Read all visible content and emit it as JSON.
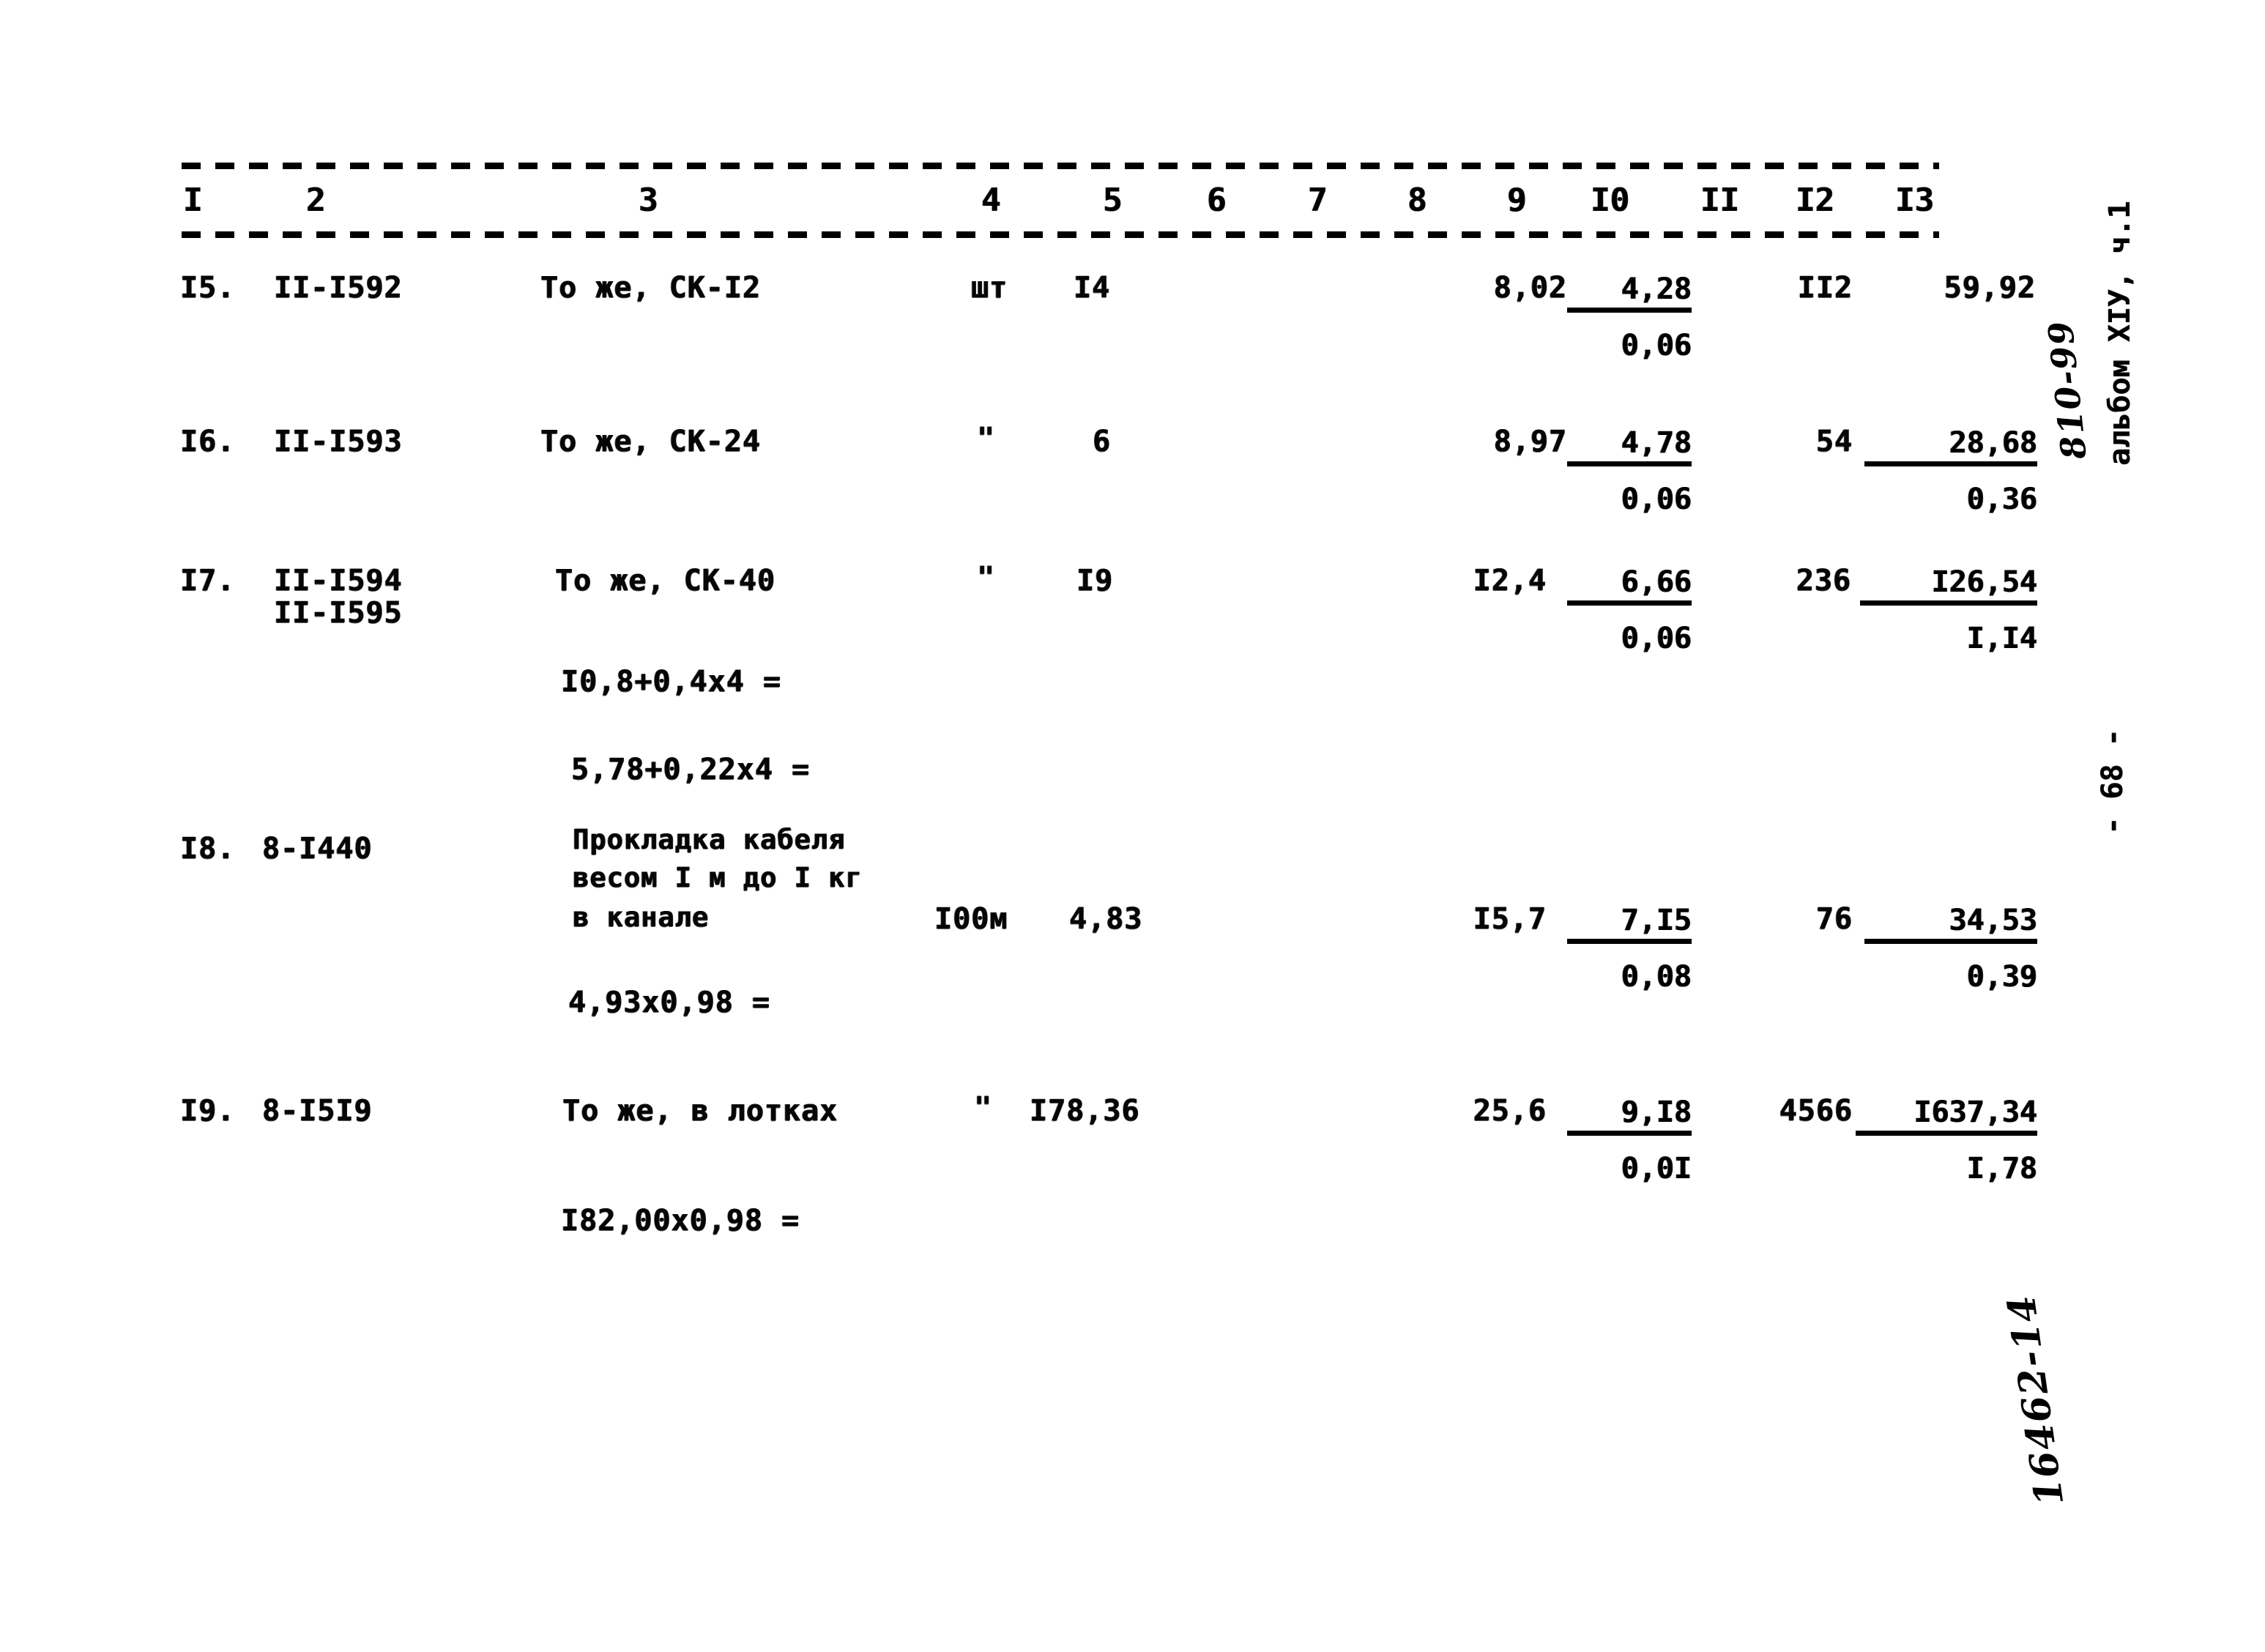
{
  "document": {
    "kind": "scanned-estimate-table",
    "margin_stamp_typed": "альбом XIУ, ч.1",
    "margin_stamp_handwritten": "810-99",
    "page_number": "- 68 -",
    "bottom_handwritten_code": "16462-14"
  },
  "table": {
    "column_numbers": [
      "I",
      "2",
      "3",
      "4",
      "5",
      "6",
      "7",
      "8",
      "9",
      "I0",
      "II",
      "I2",
      "I3"
    ],
    "rows": [
      {
        "num": "I5.",
        "code": "II-I592",
        "code2": "",
        "description": "То же, СК-I2",
        "unit": "шт",
        "quantity": "I4",
        "col8": "8,02",
        "col9_num": "4,28",
        "col9_den": "0,06",
        "col12": "II2",
        "col13_num": "59,92",
        "col13_den": ""
      },
      {
        "num": "I6.",
        "code": "II-I593",
        "code2": "",
        "description": "То же, СК-24",
        "unit": "\"",
        "quantity": "6",
        "col8": "8,97",
        "col9_num": "4,78",
        "col9_den": "0,06",
        "col12": "54",
        "col13_num": "28,68",
        "col13_den": "0,36"
      },
      {
        "num": "I7.",
        "code": "II-I594",
        "code2": "II-I595",
        "description": "То же, СК-40",
        "unit": "\"",
        "quantity": "I9",
        "col8": "I2,4",
        "col9_num": "6,66",
        "col9_den": "0,06",
        "col12": "236",
        "col13_num": "I26,54",
        "col13_den": "I,I4"
      },
      {
        "num": "I8.",
        "code": "8-I440",
        "code2": "",
        "description_line1": "Прокладка кабеля",
        "description_line2": "весом I м до I кг",
        "description_line3": "в канале",
        "unit": "I00м",
        "quantity": "4,83",
        "col8": "I5,7",
        "col9_num": "7,I5",
        "col9_den": "0,08",
        "col12": "76",
        "col13_num": "34,53",
        "col13_den": "0,39"
      },
      {
        "num": "I9.",
        "code": "8-I5I9",
        "code2": "",
        "description": "То же, в лотках",
        "unit": "\"",
        "quantity": "I78,36",
        "col8": "25,6",
        "col9_num": "9,I8",
        "col9_den": "0,0I",
        "col12": "4566",
        "col13_num": "I637,34",
        "col13_den": "I,78"
      }
    ],
    "calculations": [
      {
        "text": "I0,8+0,4x4 ="
      },
      {
        "text": "5,78+0,22x4 ="
      },
      {
        "text": "4,93x0,98 ="
      },
      {
        "text": "I82,00x0,98 ="
      }
    ]
  }
}
